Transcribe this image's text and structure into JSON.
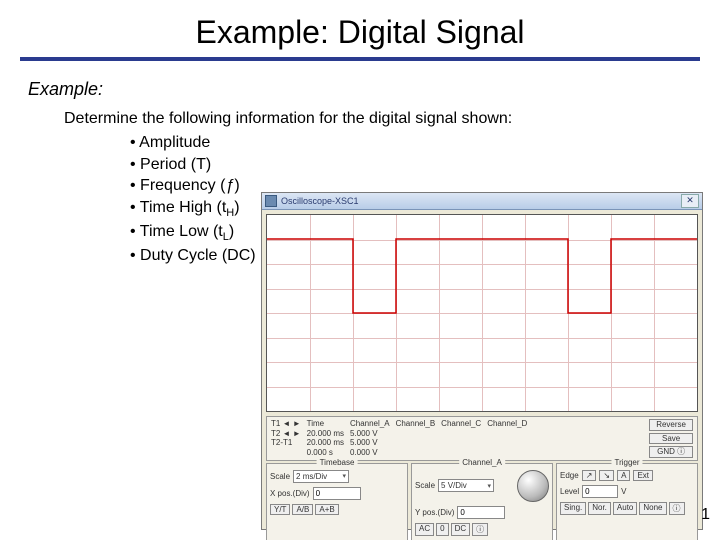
{
  "slide": {
    "title": "Example: Digital Signal",
    "example_label": "Example:",
    "intro": "Determine the following information for the digital signal shown:",
    "page_number": "1"
  },
  "bullets": {
    "b0": "Amplitude",
    "b1": "Period (T)",
    "b2_pre": "Frequency (",
    "b2_sym": "ƒ",
    "b2_post": ")",
    "b3_pre": "Time High (t",
    "b3_sub": "H",
    "b3_post": ")",
    "b4_pre": "Time Low (t",
    "b4_sub": "L",
    "b4_post": ")",
    "b5": "Duty Cycle (DC)"
  },
  "scope": {
    "window_title": "Oscilloscope-XSC1",
    "close_glyph": "✕",
    "readout": {
      "r0": "T1 ◄ ►",
      "r1": "T2 ◄ ►",
      "r2": "T2-T1",
      "time_label": "Time",
      "t1": "20.000 ms",
      "t2": "20.000 ms",
      "dt": "0.000 s",
      "ca_label": "Channel_A",
      "ca_v1": "5.000 V",
      "ca_v2": "5.000 V",
      "ca_dv": "0.000 V",
      "cb_label": "Channel_B",
      "cc_label": "Channel_C",
      "cd_label": "Channel_D",
      "reverse": "Reverse",
      "save": "Save",
      "gnd": "GND ⓘ"
    },
    "timebase": {
      "title": "Timebase",
      "scale_label": "Scale",
      "scale_value": "2 ms/Div",
      "xpos_label": "X pos.(Div)",
      "xpos_value": "0",
      "m0": "Y/T",
      "m1": "A/B",
      "m2": "A+B"
    },
    "channel_a": {
      "title": "Channel_A",
      "scale_label": "Scale",
      "scale_value": "5 V/Div",
      "ypos_label": "Y pos.(Div)",
      "ypos_value": "0",
      "m0": "AC",
      "m1": "0",
      "m2": "DC",
      "m3": "ⓘ"
    },
    "trigger": {
      "title": "Trigger",
      "edge_label": "Edge",
      "edge_btn1": "↗",
      "edge_btn2": "↘",
      "edge_src_a": "A",
      "edge_src_ext": "Ext",
      "level_label": "Level",
      "level_value": "0",
      "level_unit": "V",
      "m0": "Sing.",
      "m1": "Nor.",
      "m2": "Auto",
      "m3": "None",
      "m4": "ⓘ"
    }
  }
}
